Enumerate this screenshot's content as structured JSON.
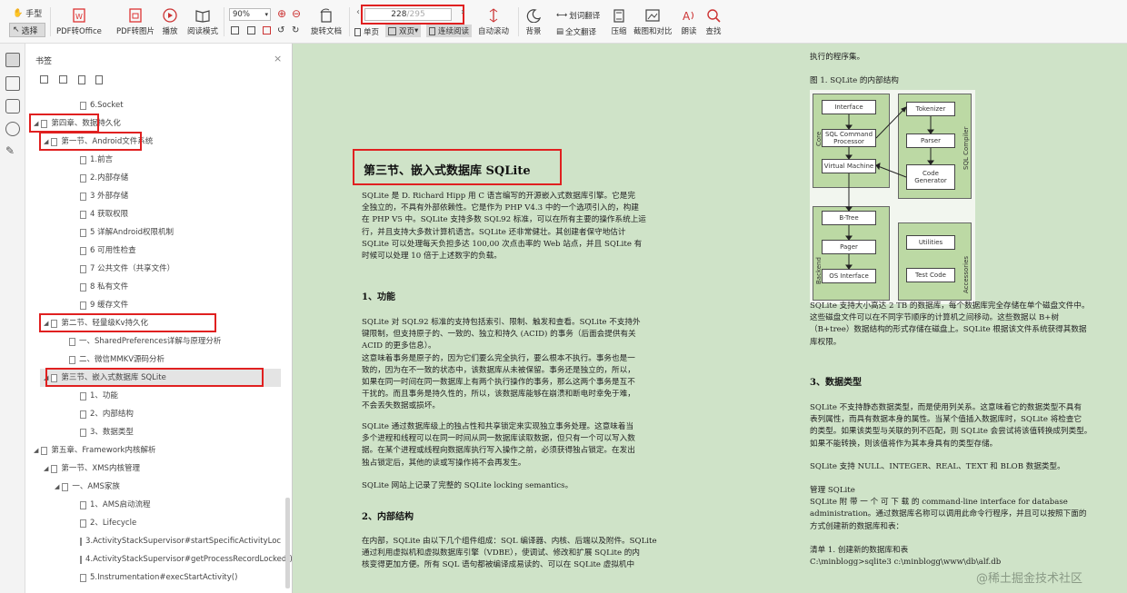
{
  "toolbar": {
    "hand": "手型",
    "select": "选择",
    "pdf_to_office": "PDF转Office",
    "pdf_to_image": "PDF转图片",
    "play": "播放",
    "read_mode": "阅读模式",
    "zoom": "90%",
    "rotate_doc": "旋转文档",
    "page_current": "228",
    "page_total": "/295",
    "single_page": "单页",
    "double_page": "双页",
    "continuous": "连续阅读",
    "auto_scroll": "自动滚动",
    "background": "背景",
    "word_translate": "划词翻译",
    "full_translate": "全文翻译",
    "compress": "压缩",
    "screenshot_compare": "截图和对比",
    "read_aloud": "朗读",
    "search": "查找"
  },
  "bookmarks": {
    "title": "书签",
    "items": [
      {
        "label": "6.Socket"
      },
      {
        "label": "第四章、数据持久化"
      },
      {
        "label": "第一节、Android文件系统"
      },
      {
        "label": "1.前言"
      },
      {
        "label": "2.内部存储"
      },
      {
        "label": "3 外部存储"
      },
      {
        "label": "4 获取权限"
      },
      {
        "label": "5 详解Android权限机制"
      },
      {
        "label": "6 可用性检查"
      },
      {
        "label": "7 公共文件（共享文件）"
      },
      {
        "label": "8 私有文件"
      },
      {
        "label": "9 缓存文件"
      },
      {
        "label": "第二节、轻量级Kv持久化"
      },
      {
        "label": "一、SharedPreferences详解与原理分析"
      },
      {
        "label": "二、微信MMKV源码分析"
      },
      {
        "label": "第三节、嵌入式数据库 SQLite"
      },
      {
        "label": "1、功能"
      },
      {
        "label": "2、内部结构"
      },
      {
        "label": "3、数据类型"
      },
      {
        "label": "第五章、Framework内核解析"
      },
      {
        "label": "第一节、XMS内核管理"
      },
      {
        "label": "一、AMS家族"
      },
      {
        "label": "1、AMS启动流程"
      },
      {
        "label": "2、Lifecycle"
      },
      {
        "label": "3.ActivityStackSupervisor#startSpecificActivityLoc"
      },
      {
        "label": "4.ActivityStackSupervisor#getProcessRecordLocked()"
      },
      {
        "label": "5.Instrumentation#execStartActivity()"
      }
    ]
  },
  "left_page": {
    "heading": "第三节、嵌入式数据库 SQLite",
    "intro": [
      "SQLite 是 D. Richard Hipp 用 C 语言编写的开源嵌入式数据库引擎。它是完",
      "全独立的，不具有外部依赖性。它是作为 PHP V4.3 中的一个选项引入的，构建",
      "在 PHP V5 中。SQLite 支持多数 SQL92 标准，可以在所有主要的操作系统上运",
      "行，并且支持大多数计算机语言。SQLite 还非常健壮。其创建者保守地估计",
      "SQLite 可以处理每天负担多达 100,00 次点击率的 Web 站点，并且 SQLite 有",
      "时候可以处理 10 倍于上述数字的负载。"
    ],
    "sec1": "1、功能",
    "sec1_p1": [
      "SQLite 对 SQL92 标准的支持包括索引、限制、触发和查看。SQLite 不支持外",
      "键限制，但支持原子的、一致的、独立和持久 (ACID) 的事务（后面会提供有关",
      "ACID 的更多信息）。",
      "这意味着事务是原子的，因为它们要么完全执行，要么根本不执行。事务也是一",
      "致的，因为在不一致的状态中，该数据库从未被保留。事务还是独立的，所以，",
      "如果在同一时间在同一数据库上有两个执行操作的事务，那么这两个事务是互不",
      "干扰的。而且事务是持久性的，所以，该数据库能够在崩溃和断电时幸免于难，",
      "不会丢失数据或损坏。"
    ],
    "sec1_p2": [
      "SQLite 通过数据库级上的独占性和共享锁定来实现独立事务处理。这意味着当",
      "多个进程和线程可以在同一时间从同一数据库读取数据，但只有一个可以写入数",
      "据。在某个进程或线程向数据库执行写入操作之前，必须获得独占锁定。在发出",
      "独占锁定后，其他的读或写操作将不会再发生。"
    ],
    "sec1_p3": "SQLite 网站上记录了完整的 SQLite locking semantics。",
    "sec2": "2、内部结构",
    "sec2_p1": [
      "在内部，SQLite 由以下几个组件组成：SQL 编译器、内核、后端以及附件。SQLite",
      "通过利用虚拟机和虚拟数据库引擎（VDBE），使调试、修改和扩展 SQLite 的内",
      "核变得更加方便。所有 SQL 语句都被编译成易读的、可以在 SQLite 虚拟机中"
    ]
  },
  "right_page": {
    "top": "执行的程序集。",
    "fig_caption": "图 1. SQLite 的内部结构",
    "diagram": {
      "core": "Core",
      "interface": "Interface",
      "sql_cmd": "SQL Command Processor",
      "vm": "Virtual Machine",
      "compiler": "SQL Compiler",
      "tokenizer": "Tokenizer",
      "parser": "Parser",
      "codegen": "Code Generator",
      "backend": "Backend",
      "btree": "B-Tree",
      "pager": "Pager",
      "os": "OS Interface",
      "accessories": "Accessories",
      "utilities": "Utilities",
      "testcode": "Test Code"
    },
    "p1": [
      "SQLite 支持大小高达 2 TB 的数据库，每个数据库完全存储在单个磁盘文件中。",
      "这些磁盘文件可以在不同字节顺序的计算机之间移动。这些数据以 B+树",
      "（B+tree）数据结构的形式存储在磁盘上。SQLite 根据该文件系统获得其数据",
      "库权限。"
    ],
    "sec3": "3、数据类型",
    "p2": [
      "SQLite 不支持静态数据类型，而是使用列关系。这意味着它的数据类型不具有",
      "表列属性，而具有数据本身的属性。当某个值插入数据库时，SQLite 将检查它",
      "的类型。如果该类型与关联的列不匹配，则 SQLite 会尝试将该值转换成列类型。",
      "如果不能转换，则该值将作为其本身具有的类型存储。"
    ],
    "p3": "SQLite 支持 NULL、INTEGER、REAL、TEXT 和 BLOB 数据类型。",
    "p4": [
      "管理 SQLite",
      "SQLite 附 带 一 个 可 下 载 的  command-line  interface  for  database",
      "administration。通过数据库名称可以调用此命令行程序，并且可以按照下面的",
      "方式创建新的数据库和表："
    ],
    "p5": [
      "清单 1. 创建新的数据库和表",
      "C:\\minblogg>sqlite3 c:\\minblogg\\www\\db\\alf.db"
    ],
    "watermark": "@稀土掘金技术社区"
  }
}
